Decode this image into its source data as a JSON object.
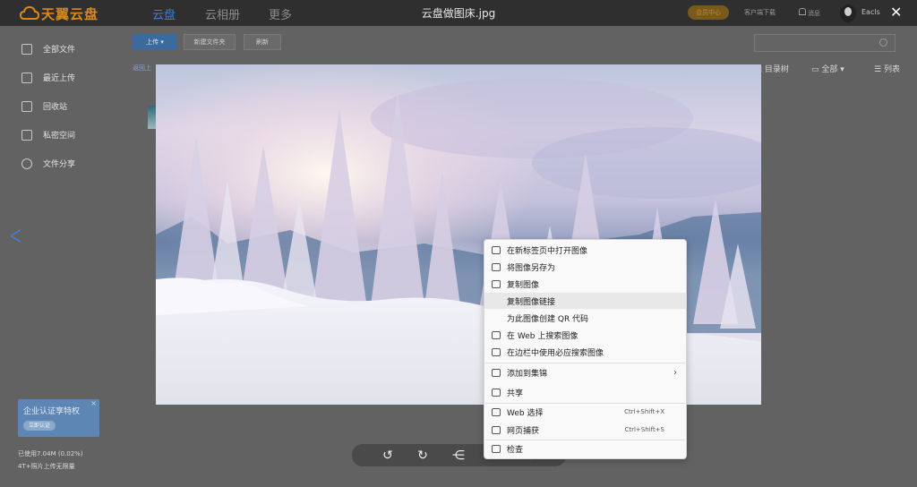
{
  "header": {
    "logo_text": "天翼云盘",
    "nav": [
      "云盘",
      "云相册",
      "更多"
    ],
    "file_title": "云盘做图床.jpg",
    "vip_label": "会员中心",
    "client_download": "客户端下载",
    "messages": "消息",
    "user_name": "Eacls"
  },
  "sidebar": {
    "items": [
      {
        "label": "全部文件",
        "icon": "file-icon"
      },
      {
        "label": "最近上传",
        "icon": "recent-upload-icon"
      },
      {
        "label": "回收站",
        "icon": "trash-icon"
      },
      {
        "label": "私密空间",
        "icon": "lock-icon"
      },
      {
        "label": "文件分享",
        "icon": "share-icon"
      }
    ],
    "banner_title": "企业认证享特权",
    "banner_button": "立即认证",
    "storage_used": "已使用7.04M (0.02%)",
    "storage_plan": "4T+照片上传无限量"
  },
  "toolbar": {
    "upload": "上传",
    "new_folder": "新建文件夹",
    "refresh": "刷新",
    "back_link": "返回上",
    "dir_tree": "目录树",
    "all_filter": "全部",
    "list_view": "列表"
  },
  "context_menu": {
    "items": [
      {
        "label": "在新标签页中打开图像",
        "shortcut": "",
        "icon": "open-new-tab-icon"
      },
      {
        "label": "将图像另存为",
        "shortcut": "",
        "icon": "save-image-icon"
      },
      {
        "label": "复制图像",
        "shortcut": "",
        "icon": "copy-image-icon"
      },
      {
        "label": "复制图像链接",
        "shortcut": "",
        "icon": ""
      },
      {
        "label": "为此图像创建 QR 代码",
        "shortcut": "",
        "icon": ""
      },
      {
        "label": "在 Web 上搜索图像",
        "shortcut": "",
        "icon": "web-search-icon"
      },
      {
        "label": "在边栏中使用必应搜索图像",
        "shortcut": "",
        "icon": "sidebar-search-icon"
      },
      {
        "label": "添加到集锦",
        "shortcut": "",
        "icon": "collections-icon"
      },
      {
        "label": "共享",
        "shortcut": "",
        "icon": "share-icon"
      },
      {
        "label": "Web 选择",
        "shortcut": "Ctrl+Shift+X",
        "icon": "web-select-icon"
      },
      {
        "label": "网页捕获",
        "shortcut": "Ctrl+Shift+S",
        "icon": "capture-icon"
      },
      {
        "label": "检查",
        "shortcut": "",
        "icon": "inspect-icon"
      }
    ]
  },
  "colors": {
    "accent": "#3d7fd6",
    "brand": "#d9881c",
    "topbar": "#2f2f2f",
    "menu_bg": "#f9f9f9"
  }
}
